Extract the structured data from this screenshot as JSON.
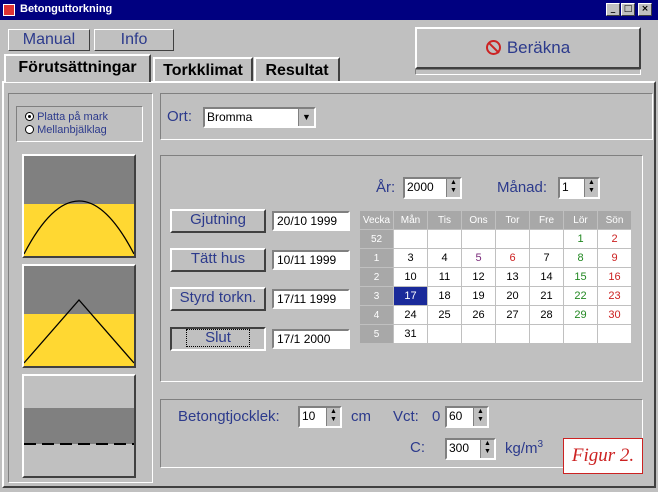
{
  "window": {
    "title": "Betonguttorkning",
    "controls": [
      "_",
      "□",
      "×"
    ]
  },
  "menu": {
    "manual": "Manual",
    "info": "Info"
  },
  "berakna": {
    "label": "Beräkna"
  },
  "tabs": [
    "Förutsättningar",
    "Torkklimat",
    "Resultat"
  ],
  "floor": {
    "option1": "Platta på mark",
    "option2": "Mellanbjälklag",
    "selected": 0
  },
  "location": {
    "label": "Ort:",
    "value": "Bromma"
  },
  "year": {
    "label": "År:",
    "value": "2000"
  },
  "month": {
    "label": "Månad:",
    "value": "1"
  },
  "dates": [
    {
      "label": "Gjutning",
      "value": "20/10 1999"
    },
    {
      "label": "Tätt hus",
      "value": "10/11 1999"
    },
    {
      "label": "Styrd torkn.",
      "value": "17/11 1999"
    },
    {
      "label": "Slut",
      "value": "17/1 2000"
    }
  ],
  "calendar": {
    "headers": [
      "Vecka",
      "Mån",
      "Tis",
      "Ons",
      "Tor",
      "Fre",
      "Lör",
      "Sön"
    ],
    "weeks": [
      {
        "wk": "52",
        "days": [
          "",
          "",
          "",
          "",
          "",
          "1",
          "2"
        ]
      },
      {
        "wk": "1",
        "days": [
          "3",
          "4",
          "5",
          "6",
          "7",
          "8",
          "9"
        ]
      },
      {
        "wk": "2",
        "days": [
          "10",
          "11",
          "12",
          "13",
          "14",
          "15",
          "16"
        ]
      },
      {
        "wk": "3",
        "days": [
          "17",
          "18",
          "19",
          "20",
          "21",
          "22",
          "23"
        ]
      },
      {
        "wk": "4",
        "days": [
          "24",
          "25",
          "26",
          "27",
          "28",
          "29",
          "30"
        ]
      },
      {
        "wk": "5",
        "days": [
          "31",
          "",
          "",
          "",
          "",
          "",
          ""
        ]
      }
    ],
    "selected": "17",
    "colors": {
      "red": "#cc2222",
      "green": "#228822",
      "purple": "#7a2a7a",
      "selected_bg": "#1a2a9a"
    }
  },
  "thickness": {
    "label": "Betongtjocklek:",
    "value": "10",
    "unit": "cm"
  },
  "vct": {
    "label": "Vct:",
    "prefix": "0",
    "value": "60"
  },
  "c": {
    "label": "C:",
    "value": "300",
    "unit": "kg/m",
    "sup": "3"
  },
  "figure": {
    "caption": "Figur 2."
  }
}
